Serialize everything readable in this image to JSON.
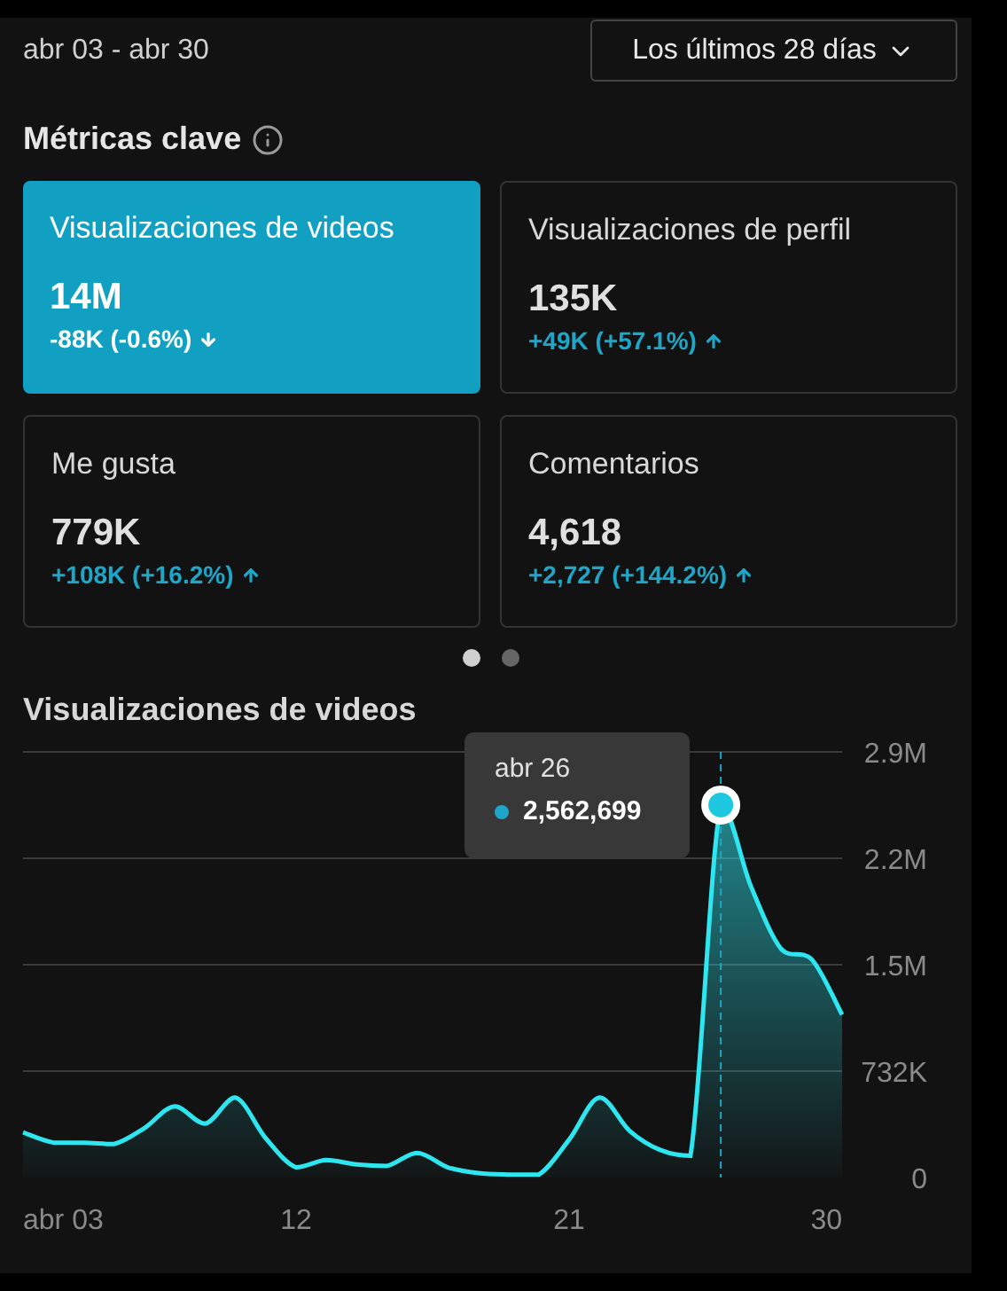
{
  "date_range": "abr 03 - abr 30",
  "period_dropdown": {
    "label": "Los últimos 28 días"
  },
  "section_title": "Métricas clave",
  "metrics": [
    {
      "label": "Visualizaciones de videos",
      "value": "14M",
      "change": "-88K (-0.6%)",
      "kind": "down",
      "selected": true
    },
    {
      "label": "Visualizaciones de perfil",
      "value": "135K",
      "change": "+49K (+57.1%)",
      "kind": "up",
      "selected": false
    },
    {
      "label": "Me gusta",
      "value": "779K",
      "change": "+108K (+16.2%)",
      "kind": "up",
      "selected": false
    },
    {
      "label": "Comentarios",
      "value": "4,618",
      "change": "+2,727 (+144.2%)",
      "kind": "up",
      "selected": false
    }
  ],
  "pager": [
    {
      "selected": true
    },
    {
      "selected": false
    }
  ],
  "chart": {
    "title": "Visualizaciones de videos",
    "tooltip": {
      "date": "abr 26",
      "value": "2,562,699"
    },
    "chart_data": {
      "type": "area",
      "grid": true,
      "x": [
        3,
        4,
        5,
        6,
        7,
        8,
        9,
        10,
        11,
        12,
        13,
        14,
        15,
        16,
        17,
        18,
        19,
        20,
        21,
        22,
        23,
        24,
        25,
        26,
        27,
        28,
        29,
        30
      ],
      "series": [
        {
          "color": "#2ee6f0",
          "values": [
            310000,
            240000,
            240000,
            230000,
            340000,
            490000,
            370000,
            550000,
            270000,
            70000,
            120000,
            90000,
            80000,
            170000,
            70000,
            30000,
            20000,
            20000,
            260000,
            550000,
            320000,
            190000,
            150000,
            2562699,
            2000000,
            1570000,
            1500000,
            1120000
          ]
        }
      ],
      "xlim": [
        3,
        30
      ],
      "ref_lines": [
        {
          "axis": "x",
          "value": 26
        }
      ],
      "xticks": [
        {
          "value": 3,
          "label": "abr 03"
        },
        {
          "value": 12,
          "label": "12"
        },
        {
          "value": 21,
          "label": "21"
        },
        {
          "value": 30,
          "label": "30"
        }
      ],
      "yticks": [
        {
          "value": 0,
          "label": "0"
        },
        {
          "value": 732000,
          "label": "732K"
        },
        {
          "value": 1464000,
          "label": "1.5M"
        },
        {
          "value": 2196000,
          "label": "2.2M"
        },
        {
          "value": 2928000,
          "label": "2.9M"
        }
      ],
      "ylim": [
        0,
        2928000
      ]
    }
  }
}
